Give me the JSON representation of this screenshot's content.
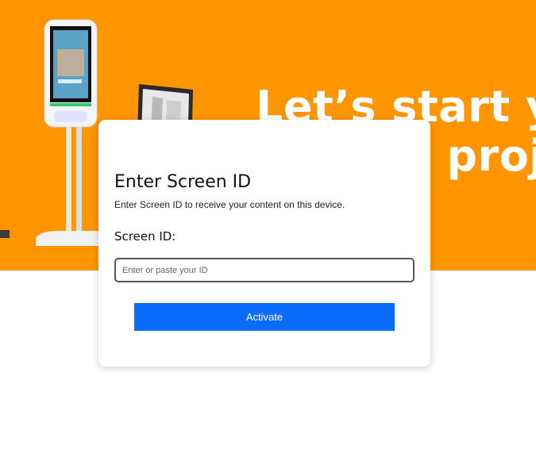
{
  "banner": {
    "headline_line1": "Let’s start yo",
    "headline_line2": "e proj",
    "background_color": "#ff9500",
    "images": [
      "kiosk-stand-image",
      "tablet-image"
    ]
  },
  "modal": {
    "title": "Enter Screen ID",
    "subtitle": "Enter Screen ID to receive your content on this device.",
    "field_label": "Screen ID:",
    "input_value": "",
    "input_placeholder": "Enter or paste your ID",
    "activate_label": "Activate",
    "accent_color": "#0a6cff"
  }
}
